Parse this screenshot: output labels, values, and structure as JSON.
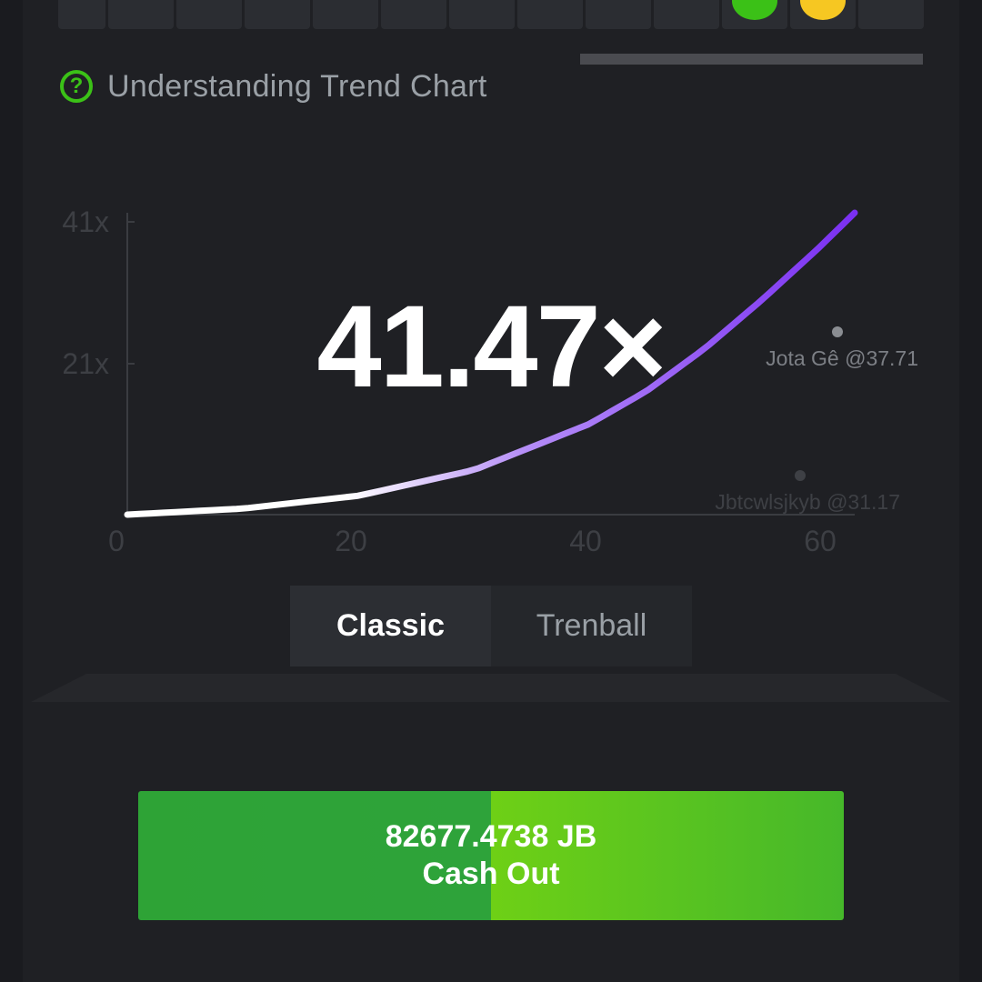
{
  "trend_row": {
    "cells": [
      {
        "color": ""
      },
      {
        "color": ""
      },
      {
        "color": ""
      },
      {
        "color": ""
      },
      {
        "color": ""
      },
      {
        "color": ""
      },
      {
        "color": ""
      },
      {
        "color": ""
      },
      {
        "color": ""
      },
      {
        "color": ""
      },
      {
        "color": "#3bc117"
      },
      {
        "color": "#f6c722"
      },
      {
        "color": ""
      }
    ]
  },
  "help": {
    "icon": "question-circle-icon",
    "label": "Understanding Trend Chart"
  },
  "chart_data": {
    "type": "line",
    "x_ticks": [
      "0",
      "20",
      "40",
      "60"
    ],
    "y_ticks": [
      "21x",
      "41x"
    ],
    "xlim": [
      0,
      63
    ],
    "ylim": [
      1,
      41
    ],
    "current_multiplier": "41.47×",
    "series": [
      {
        "x": [
          0,
          10,
          20,
          30,
          40,
          45,
          50,
          55,
          60,
          63
        ],
        "values": [
          1.0,
          1.8,
          3.5,
          6.9,
          13.0,
          17.4,
          23.0,
          29.5,
          36.5,
          41.0
        ]
      }
    ],
    "players": [
      {
        "label": "Jota Gê @37.71",
        "x": 61,
        "y": 26.3
      },
      {
        "label": "Jbtcwlsjkyb @31.17",
        "x": 58,
        "y": 6.7
      }
    ],
    "colors": {
      "curve_start": "#ffffff",
      "curve_end": "#7a2ff2"
    }
  },
  "modes": {
    "classic": "Classic",
    "trenball": "Trenball",
    "active": "classic"
  },
  "cashout": {
    "amount": "82677.4738 JB",
    "label": "Cash Out",
    "color": "#3bc117"
  }
}
